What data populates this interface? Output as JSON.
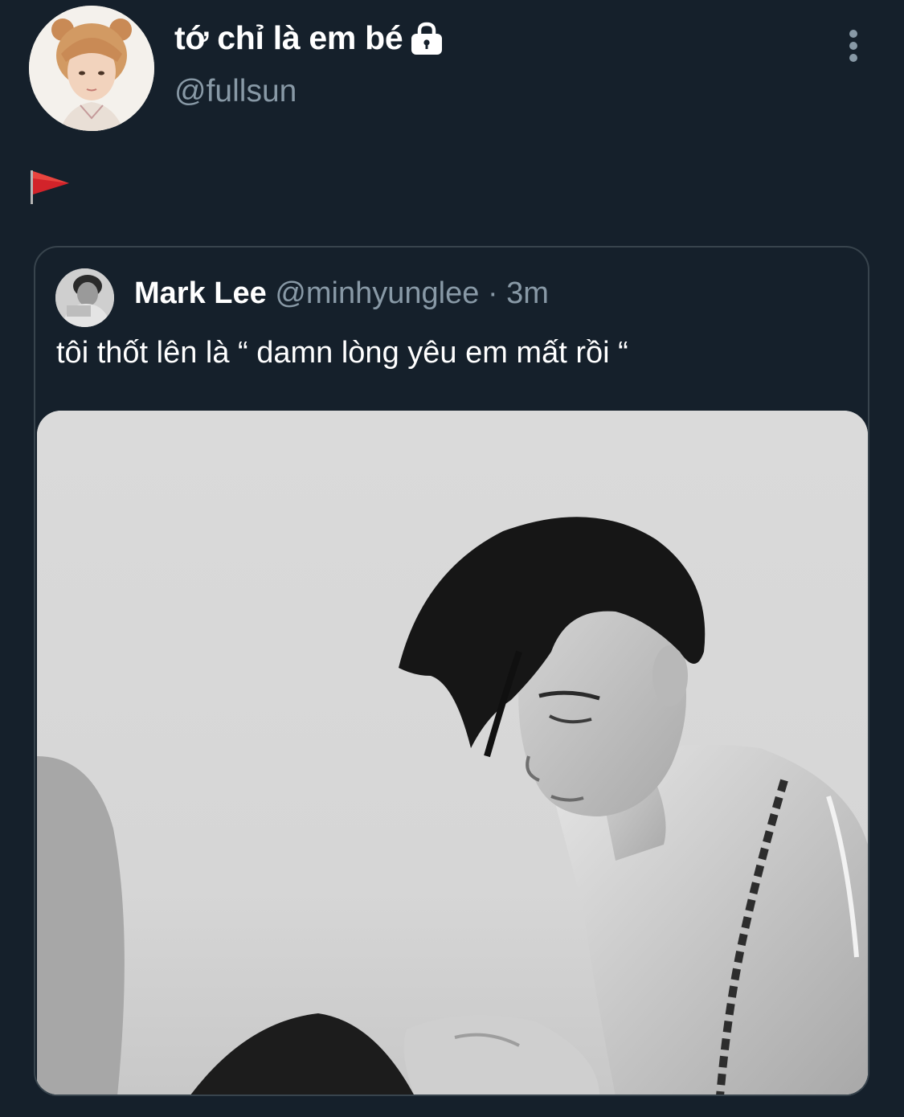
{
  "tweet": {
    "author": {
      "display_name": "tớ chỉ là em bé",
      "handle": "@fullsun",
      "protected_icon": "lock-icon",
      "avatar_icon": "avatar"
    },
    "body_icon": "red-flag-icon",
    "menu_icon": "more-vertical-icon",
    "quoted": {
      "display_name": "Mark Lee",
      "handle": "@minhyunglee",
      "separator": "·",
      "time": "3m",
      "text": "tôi thốt lên là “ damn lòng yêu em mất rồi “",
      "media_icon": "photo"
    }
  },
  "colors": {
    "background": "#15202b",
    "primary_text": "#ffffff",
    "secondary_text": "#8899a6",
    "border": "#38444d",
    "flag": "#d2232a"
  }
}
